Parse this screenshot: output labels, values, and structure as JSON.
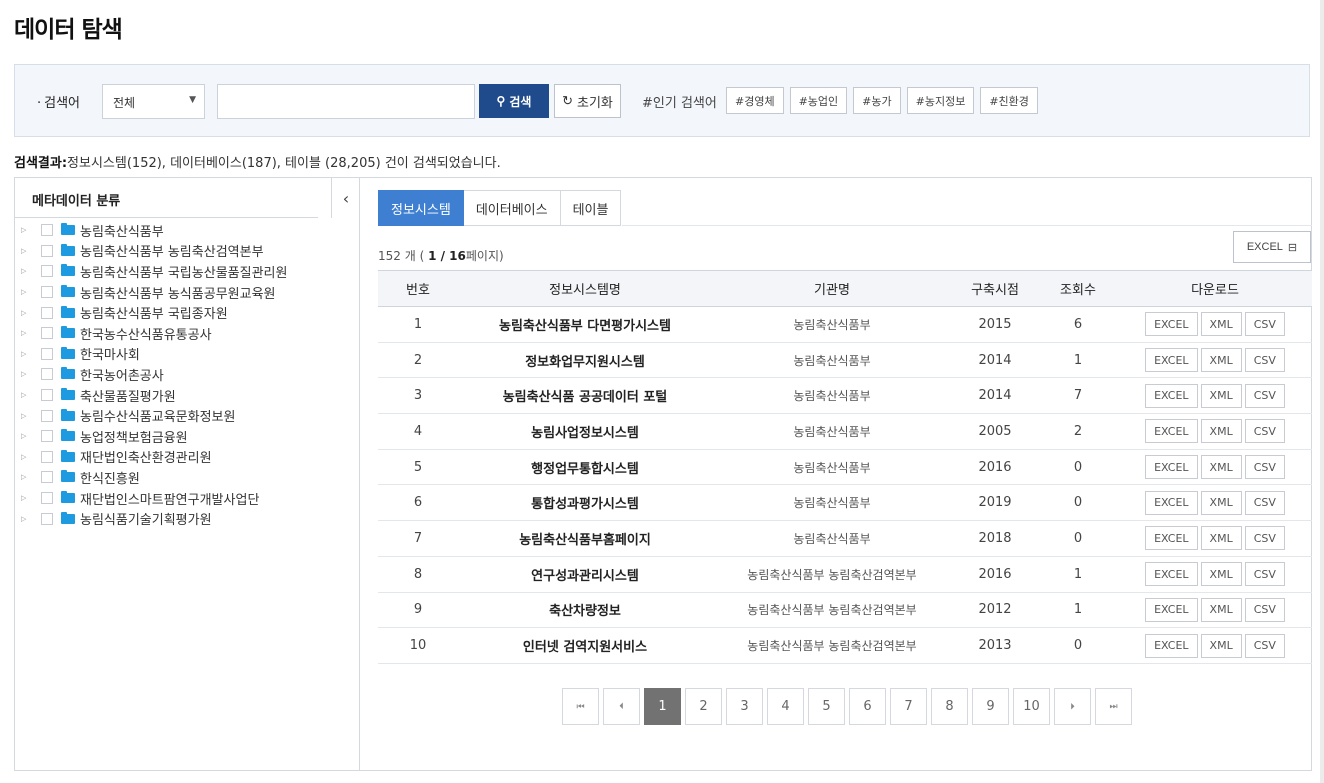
{
  "page": {
    "title": "데이터 탐색"
  },
  "search": {
    "label": "검색어",
    "select_value": "전체",
    "input_value": "",
    "input_placeholder": "",
    "search_label": "검색",
    "reset_label": "초기화",
    "popular_label": "#인기 검색어",
    "popular_tags": [
      "#경영체",
      "#농업인",
      "#농가",
      "#농지정보",
      "#친환경"
    ]
  },
  "result": {
    "label": "검색결과:",
    "text": "정보시스템(152), 데이터베이스(187), 테이블 (28,205) 건이 검색되었습니다."
  },
  "meta": {
    "title": "메타데이터 분류",
    "collapse_icon": "chevron-left-icon",
    "items": [
      "농림축산식품부",
      "농림축산식품부 농림축산검역본부",
      "농림축산식품부 국립농산물품질관리원",
      "농림축산식품부 농식품공무원교육원",
      "농림축산식품부 국립종자원",
      "한국농수산식품유통공사",
      "한국마사회",
      "한국농어촌공사",
      "축산물품질평가원",
      "농림수산식품교육문화정보원",
      "농업정책보험금융원",
      "재단법인축산환경관리원",
      "한식진흥원",
      "재단법인스마트팜연구개발사업단",
      "농림식품기술기획평가원"
    ]
  },
  "tabs": [
    "정보시스템",
    "데이터베이스",
    "테이블"
  ],
  "count": {
    "prefix": "152 개 ( ",
    "page": "1 / 16",
    "suffix": "페이지)"
  },
  "excel_top": "EXCEL",
  "table": {
    "headers": [
      "번호",
      "정보시스템명",
      "기관명",
      "구축시점",
      "조회수",
      "다운로드"
    ],
    "download_labels": [
      "EXCEL",
      "XML",
      "CSV"
    ],
    "rows": [
      {
        "no": "1",
        "name": "농림축산식품부 다면평가시스템",
        "org": "농림축산식품부",
        "year": "2015",
        "views": "6"
      },
      {
        "no": "2",
        "name": "정보화업무지원시스템",
        "org": "농림축산식품부",
        "year": "2014",
        "views": "1"
      },
      {
        "no": "3",
        "name": "농림축산식품 공공데이터 포털",
        "org": "농림축산식품부",
        "year": "2014",
        "views": "7"
      },
      {
        "no": "4",
        "name": "농림사업정보시스템",
        "org": "농림축산식품부",
        "year": "2005",
        "views": "2"
      },
      {
        "no": "5",
        "name": "행정업무통합시스템",
        "org": "농림축산식품부",
        "year": "2016",
        "views": "0"
      },
      {
        "no": "6",
        "name": "통합성과평가시스템",
        "org": "농림축산식품부",
        "year": "2019",
        "views": "0"
      },
      {
        "no": "7",
        "name": "농림축산식품부홈페이지",
        "org": "농림축산식품부",
        "year": "2018",
        "views": "0"
      },
      {
        "no": "8",
        "name": "연구성과관리시스템",
        "org": "농림축산식품부 농림축산검역본부",
        "year": "2016",
        "views": "1"
      },
      {
        "no": "9",
        "name": "축산차량정보",
        "org": "농림축산식품부 농림축산검역본부",
        "year": "2012",
        "views": "1"
      },
      {
        "no": "10",
        "name": "인터넷 검역지원서비스",
        "org": "농림축산식품부 농림축산검역본부",
        "year": "2013",
        "views": "0"
      }
    ]
  },
  "pagination": {
    "first": "⏮",
    "prev": "⏴",
    "next": "⏵",
    "last": "⏭",
    "pages": [
      "1",
      "2",
      "3",
      "4",
      "5",
      "6",
      "7",
      "8",
      "9",
      "10"
    ],
    "current": "1"
  },
  "colors": {
    "primary": "#1f4b8c",
    "tab_active": "#3f7fd1",
    "page_active": "#727272",
    "folder": "#1e9be0"
  }
}
